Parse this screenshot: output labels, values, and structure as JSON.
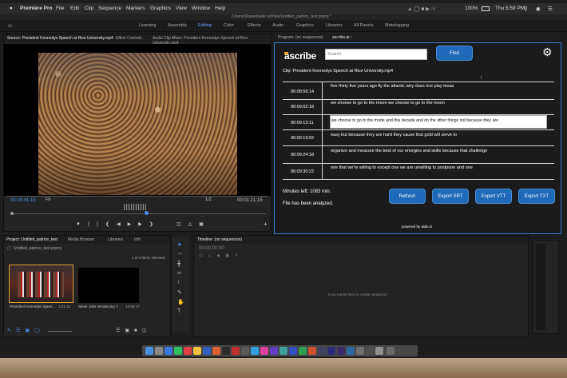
{
  "menubar": {
    "app": "Premiere Pro",
    "items": [
      "File",
      "Edit",
      "Clip",
      "Sequence",
      "Markers",
      "Graphics",
      "View",
      "Window",
      "Help"
    ],
    "battery": "100%",
    "clock": "Thu 5:59 PM"
  },
  "path": "/Users/Shared/aele scPollo/Untitled_patrice_test.prproj *",
  "workspaces": [
    "Learning",
    "Assembly",
    "Editing",
    "Color",
    "Effects",
    "Audio",
    "Graphics",
    "Libraries",
    "All Panels",
    "Metalogging"
  ],
  "source": {
    "tabs": [
      "Source: President Kennedys Speech at Rice University.mp4",
      "Effect Controls",
      "Audio Clip Mixer: President Kennedys Speech at Rice University.mp4"
    ],
    "timecode": "00:09:41:15",
    "fit": "Fit",
    "fraction": "1/2",
    "duration": "00:01:21:15"
  },
  "ascribe": {
    "tabs": [
      "Program: (no sequences)",
      "ascribe.ai"
    ],
    "logo": "ascribe",
    "search_placeholder": "Search",
    "find": "Find",
    "clip": "Clip: President Kennedys Speech at Rice University.mp4",
    "rows": [
      {
        "time": "00:08:56:14",
        "text": "five thirty five years ago fly the atlantic why does rice play texas"
      },
      {
        "time": "00:09:02:18",
        "text": "we choose to go to the moon we choose to go to the moon"
      },
      {
        "time": "00:09:13:11",
        "text": "we choose to go to the mode and this decade and do the other things not because they are"
      },
      {
        "time": "00:09:19:02",
        "text": "easy but because they are hard they cause that gold will serve to"
      },
      {
        "time": "00:09:24:18",
        "text": "organize and measure the best of our energies and skills because that challenge"
      },
      {
        "time": "00:09:30:22",
        "text": "one that we're willing to except one we are unwilling to postpone and one"
      }
    ],
    "minutes": "Minutes left: 1083 min.",
    "status": "File has been analyzed.",
    "buttons": [
      "Refresh",
      "Export SRT",
      "Export VTT",
      "Export TXT"
    ],
    "powered": "powered by aide.ai"
  },
  "project": {
    "tabs": [
      "Project: Untitled_patrice_test",
      "Media Browser",
      "Libraries",
      "Info"
    ],
    "file": "Untitled_patrice_test.prproj",
    "items_count": "1 of 2 items selected",
    "clips": [
      {
        "name": "President Kennedys Speec...",
        "dur": "1:21:15"
      },
      {
        "name": "Steve Jobs Introducing T...",
        "dur": "13:59:17"
      }
    ]
  },
  "timeline": {
    "tab": "Timeline: (no sequences)",
    "timecode": "00;00;00;00",
    "drop": "Drop media here to create sequence."
  },
  "colors": {
    "accent": "#1f69b9",
    "workspace_active": "#6fa4ff",
    "timecode": "#4e8ee8"
  }
}
